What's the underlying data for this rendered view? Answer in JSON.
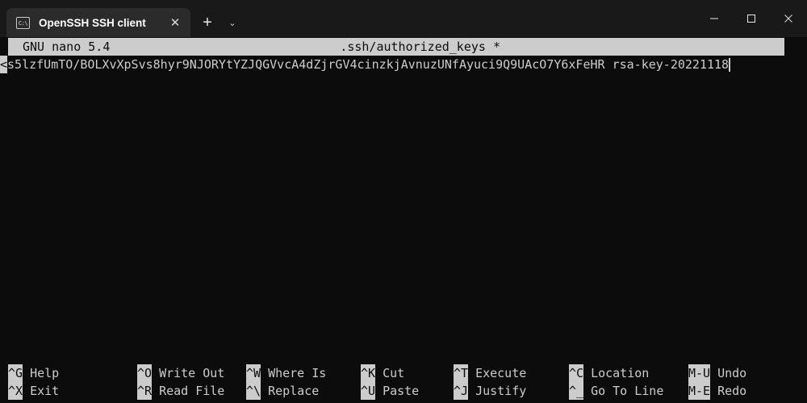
{
  "window": {
    "tab": {
      "icon": "console-icon",
      "icon_text": "C:\\",
      "title": "OpenSSH SSH client",
      "close_glyph": "✕"
    },
    "new_tab_glyph": "+",
    "tab_dropdown_glyph": "⌄",
    "controls": {
      "minimize": "—",
      "maximize": "□",
      "close": "✕"
    }
  },
  "nano": {
    "title": {
      "version": "GNU nano 5.4",
      "filename": ".ssh/authorized_keys *"
    },
    "buffer": {
      "continuation_marker": "<",
      "line_text": "s5lzfUmTO/BOLXvXpSvs8hyr9NJORYtYZJQGVvcA4dZjrGV4cinzkjAvnuzUNfAyuci9Q9UAcO7Y6xFeHR rsa-key-20221118"
    },
    "shortcuts": {
      "row1": [
        {
          "key": "^G",
          "label": "Help"
        },
        {
          "key": "^O",
          "label": "Write Out"
        },
        {
          "key": "^W",
          "label": "Where Is"
        },
        {
          "key": "^K",
          "label": "Cut"
        },
        {
          "key": "^T",
          "label": "Execute"
        },
        {
          "key": "^C",
          "label": "Location"
        },
        {
          "key": "M-U",
          "label": "Undo"
        }
      ],
      "row2": [
        {
          "key": "^X",
          "label": "Exit"
        },
        {
          "key": "^R",
          "label": "Read File"
        },
        {
          "key": "^\\",
          "label": "Replace"
        },
        {
          "key": "^U",
          "label": "Paste"
        },
        {
          "key": "^J",
          "label": "Justify"
        },
        {
          "key": "^_",
          "label": "Go To Line"
        },
        {
          "key": "M-E",
          "label": "Redo"
        }
      ]
    }
  },
  "colors": {
    "terminal_bg": "#0c0c0c",
    "terminal_fg": "#cccccc",
    "titlebar_bg": "#191919",
    "tab_bg": "#2b2b2b",
    "inverted_bg": "#cccccc",
    "inverted_fg": "#0c0c0c"
  }
}
